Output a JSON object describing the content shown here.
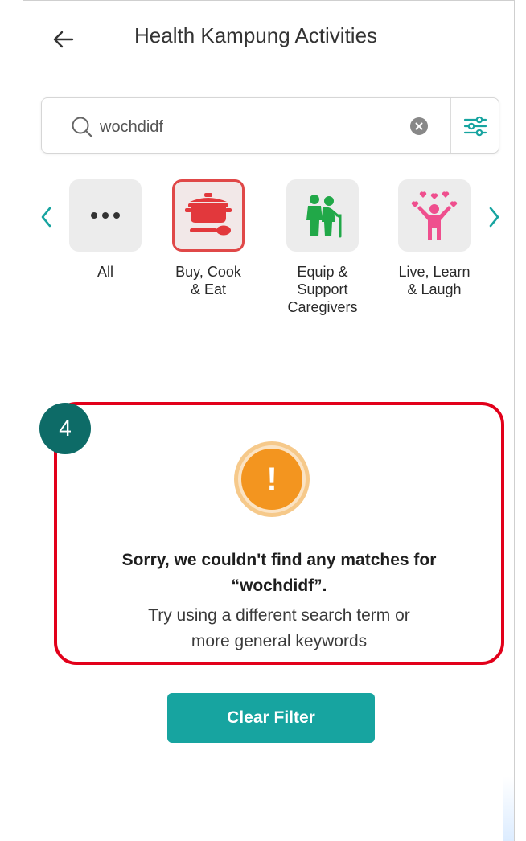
{
  "header": {
    "title": "Health Kampung Activities",
    "back_icon": "arrow-left-icon"
  },
  "search": {
    "value": "wochdidf",
    "placeholder": "Search",
    "search_icon": "search-icon",
    "clear_icon": "clear-circle-icon",
    "filter_icon": "sliders-icon"
  },
  "categories": [
    {
      "label": "All",
      "icon": "more-dots-icon",
      "selected": false
    },
    {
      "label": "Buy, Cook\n& Eat",
      "icon": "cooking-pot-icon",
      "selected": true
    },
    {
      "label": "Equip &\nSupport\nCaregivers",
      "icon": "caregiver-icon",
      "selected": false
    },
    {
      "label": "Live, Learn\n& Laugh",
      "icon": "hearts-person-icon",
      "selected": false
    }
  ],
  "empty_state": {
    "badge": "4",
    "icon": "exclamation-icon",
    "title_line1": "Sorry, we couldn't find any matches for",
    "title_line2": "“wochdidf”.",
    "subtitle_line1": "Try using a different search term or",
    "subtitle_line2": "more general keywords"
  },
  "actions": {
    "clear_filter": "Clear Filter"
  },
  "colors": {
    "accent": "#17a4a0",
    "selected_border": "#e04848",
    "highlight": "#e2001a",
    "badge": "#0d6b67",
    "alert": "#f3951f",
    "nav_arrow": "#17a4a0"
  }
}
